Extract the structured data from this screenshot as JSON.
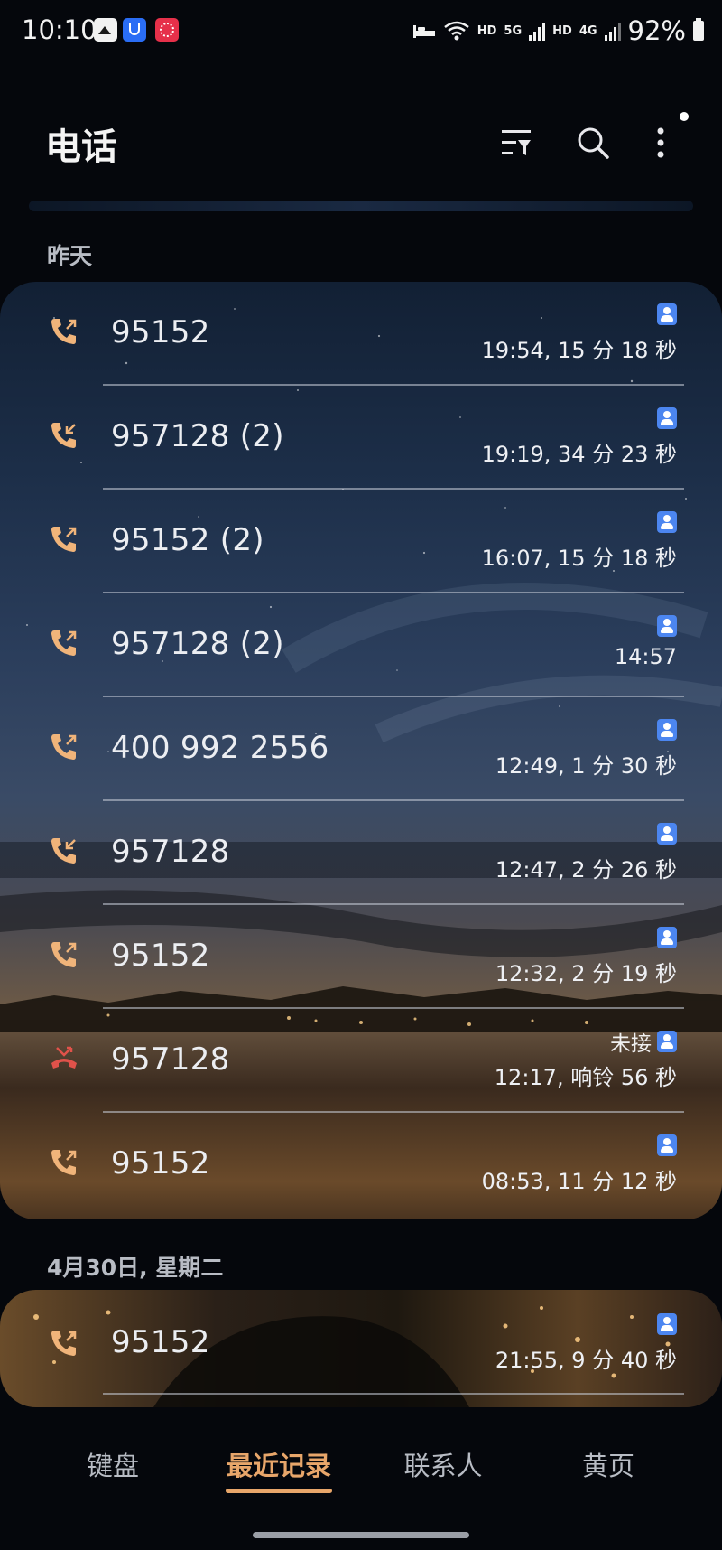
{
  "status_bar": {
    "time": "10:10",
    "net1": "HD",
    "net2": "5G",
    "net3": "HD",
    "net4": "4G",
    "battery": "92%"
  },
  "header": {
    "title": "电话",
    "filter_icon": "filter-icon",
    "search_icon": "search-icon",
    "more_icon": "more-vertical-icon"
  },
  "sections": [
    {
      "label": "昨天",
      "calls": [
        {
          "number": "95152",
          "meta": "19:54, 15 分 18 秒",
          "status": "",
          "type": "outgoing"
        },
        {
          "number": "957128 (2)",
          "meta": "19:19, 34 分 23 秒",
          "status": "",
          "type": "incoming"
        },
        {
          "number": "95152 (2)",
          "meta": "16:07, 15 分 18 秒",
          "status": "",
          "type": "outgoing"
        },
        {
          "number": "957128 (2)",
          "meta": "14:57",
          "status": "",
          "type": "outgoing"
        },
        {
          "number": "400 992 2556",
          "meta": "12:49, 1 分 30 秒",
          "status": "",
          "type": "outgoing"
        },
        {
          "number": "957128",
          "meta": "12:47, 2 分 26 秒",
          "status": "",
          "type": "incoming"
        },
        {
          "number": "95152",
          "meta": "12:32, 2 分 19 秒",
          "status": "",
          "type": "outgoing"
        },
        {
          "number": "957128",
          "meta": "12:17, 响铃 56 秒",
          "status": "未接",
          "type": "missed"
        },
        {
          "number": "95152",
          "meta": "08:53, 11 分 12 秒",
          "status": "",
          "type": "outgoing"
        }
      ]
    },
    {
      "label": "4月30日, 星期二",
      "calls": [
        {
          "number": "95152",
          "meta": "21:55, 9 分 40 秒",
          "status": "",
          "type": "outgoing"
        }
      ]
    }
  ],
  "nav": {
    "tabs": [
      "键盘",
      "最近记录",
      "联系人",
      "黄页"
    ],
    "active_index": 1
  },
  "colors": {
    "accent": "#e8a66a",
    "missed": "#e0524a",
    "contact_badge": "#4c86f0"
  }
}
